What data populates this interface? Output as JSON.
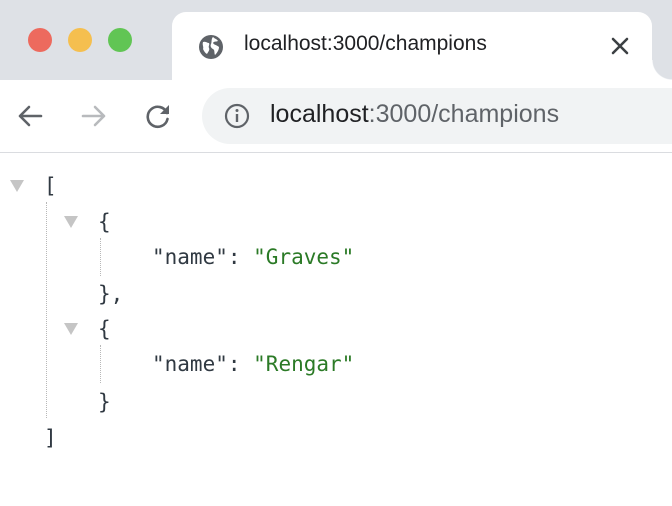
{
  "tab": {
    "title": "localhost:3000/champions",
    "favicon": "globe-icon",
    "close": "close-icon"
  },
  "toolbar": {
    "back": "arrow-left-icon",
    "forward": "arrow-right-icon",
    "reload": "reload-icon"
  },
  "omnibox": {
    "info": "info-icon",
    "host": "localhost",
    "path": ":3000/champions"
  },
  "json": {
    "open_bracket": "[",
    "close_bracket": "]",
    "items": [
      {
        "open": "{",
        "key": "\"name\"",
        "sep": ": ",
        "value": "\"Graves\"",
        "close": "},",
        "raw_value": "Graves"
      },
      {
        "open": "{",
        "key": "\"name\"",
        "sep": ": ",
        "value": "\"Rengar\"",
        "close": "}",
        "raw_value": "Rengar"
      }
    ]
  },
  "colors": {
    "tabstrip": "#dee1e6",
    "traffic_close": "#ed6a5e",
    "traffic_min": "#f5bf4f",
    "traffic_max": "#61c554",
    "string": "#2b7a26",
    "text": "#303942"
  }
}
